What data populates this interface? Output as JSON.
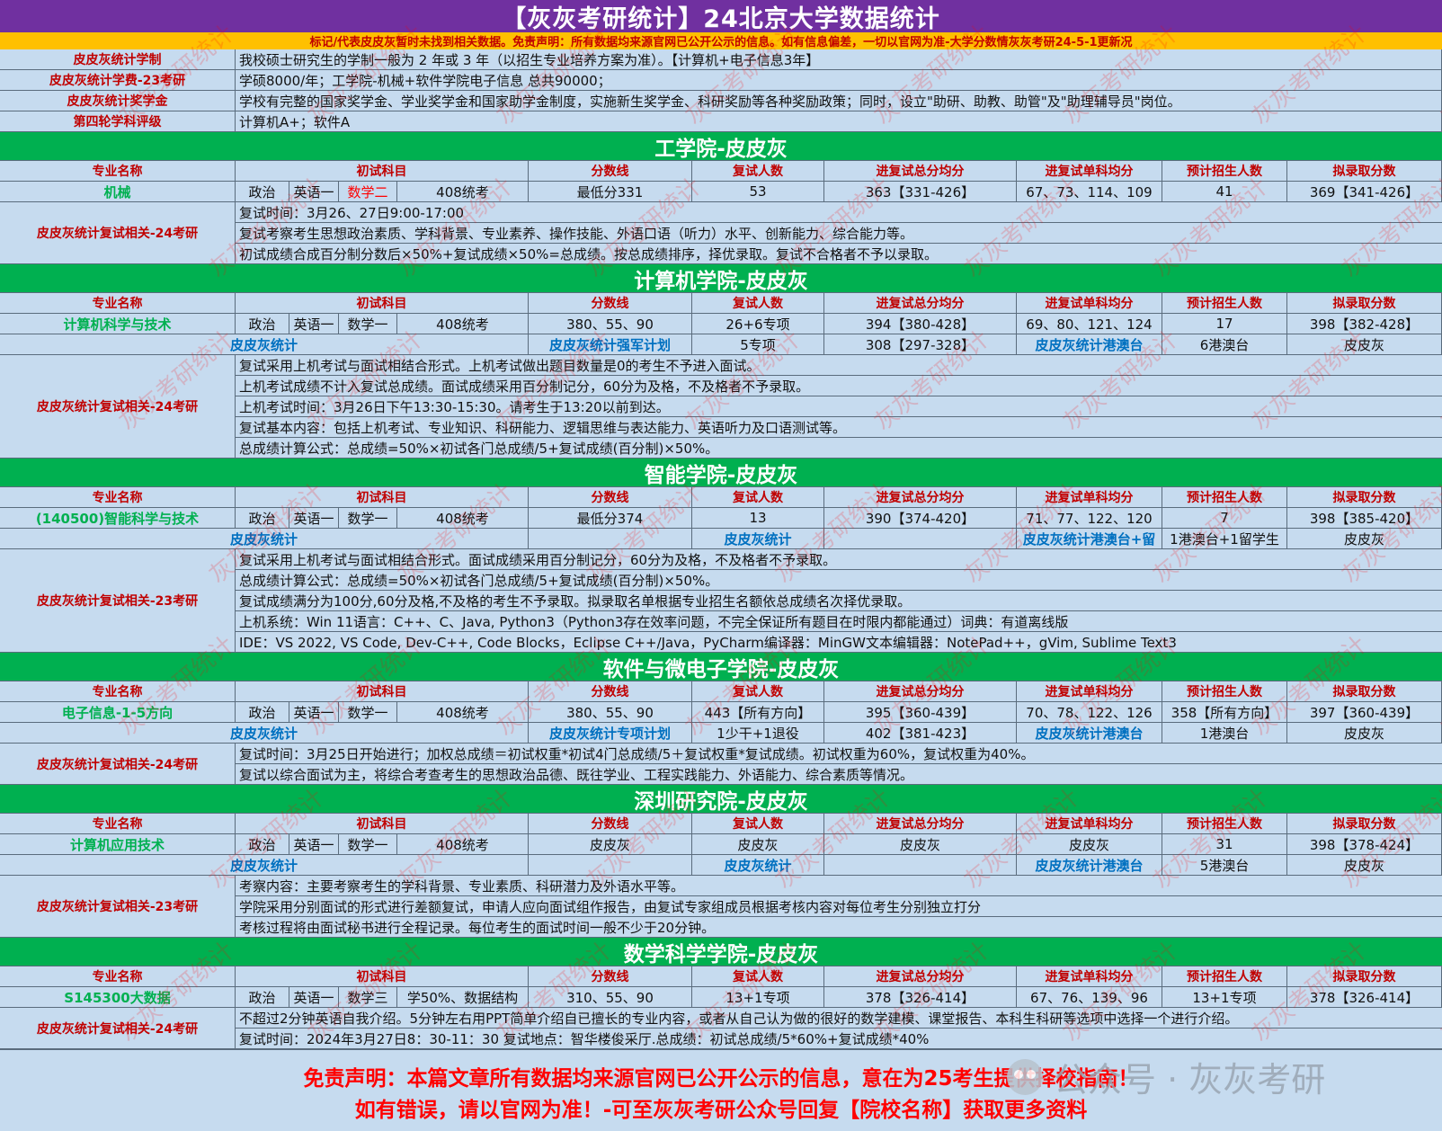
{
  "title": "【灰灰考研统计】24北京大学数据统计",
  "notice": "标记/代表皮皮灰暂时未找到相关数据。免责声明：所有数据均来源官网已公开公示的信息。如有信息偏差，一切以官网为准-大学分数情灰灰考研24-5-1更新况",
  "info_rows": [
    {
      "label": "皮皮灰统计学制",
      "value": "我校硕士研究生的学制一般为 2 年或 3 年（以招生专业培养方案为准）。【计算机+电子信息3年】"
    },
    {
      "label": "皮皮灰统计学费-23考研",
      "value": "学硕8000/年；工学院-机械+软件学院电子信息 总共90000；"
    },
    {
      "label": "皮皮灰统计奖学金",
      "value": "学校有完整的国家奖学金、学业奖学金和国家助学金制度，实施新生奖学金、科研奖励等各种奖励政策；同时，设立\"助研、助教、助管\"及\"助理辅导员\"岗位。"
    },
    {
      "label": "第四轮学科评级",
      "value": "计算机A+；软件A"
    }
  ],
  "headers": {
    "major": "专业名称",
    "subjects": "初试科目",
    "cutoff": "分数线",
    "retest_count": "复试人数",
    "avg_total": "进复试总分均分",
    "avg_single": "进复试单科均分",
    "plan": "预计招生人数",
    "admit": "拟录取分数"
  },
  "sections": [
    {
      "title": "工学院-皮皮灰",
      "major": "机械",
      "s1": "政治",
      "s2": "英语一",
      "s3": "数学二",
      "s3_red": true,
      "s4": "408统考",
      "cutoff": "最低分331",
      "retest_count": "53",
      "avg_total": "363【331-426】",
      "avg_single": "67、73、114、109",
      "plan": "41",
      "admit": "369【341-426】",
      "extra": [],
      "block_label": "皮皮灰统计复试相关-24考研",
      "lines": [
        "复试时间：3月26、27日9:00-17:00",
        "复试考察考生思想政治素质、学科背景、专业素养、操作技能、外语口语（听力）水平、创新能力、综合能力等。",
        "初试成绩合成百分制分数后×50%+复试成绩×50%=总成绩。按总成绩排序，择优录取。复试不合格者不予以录取。"
      ]
    },
    {
      "title": "计算机学院-皮皮灰",
      "major": "计算机科学与技术",
      "s1": "政治",
      "s2": "英语一",
      "s3": "数学一",
      "s3_red": false,
      "s4": "408统考",
      "cutoff": "380、55、90",
      "retest_count": "26+6专项",
      "avg_total": "394【380-428】",
      "avg_single": "69、80、121、124",
      "plan": "17",
      "admit": "398【382-428】",
      "extra": [
        {
          "a": "皮皮灰统计",
          "b": "皮皮灰统计强军计划",
          "c": "5专项",
          "d": "308【297-328】",
          "e": "皮皮灰统计港澳台",
          "f": "6港澳台",
          "g": "皮皮灰"
        }
      ],
      "block_label": "皮皮灰统计复试相关-24考研",
      "lines": [
        "复试采用上机考试与面试相结合形式。上机考试做出题目数量是0的考生不予进入面试。",
        "上机考试成绩不计入复试总成绩。面试成绩采用百分制记分，60分为及格，不及格者不予录取。",
        "上机考试时间：3月26日下午13:30-15:30。请考生于13:20以前到达。",
        "复试基本内容：包括上机考试、专业知识、科研能力、逻辑思维与表达能力、英语听力及口语测试等。",
        "总成绩计算公式：总成绩=50%×初试各门总成绩/5+复试成绩(百分制)×50%。"
      ]
    },
    {
      "title": "智能学院-皮皮灰",
      "major": "(140500)智能科学与技术",
      "s1": "政治",
      "s2": "英语一",
      "s3": "数学一",
      "s3_red": false,
      "s4": "408统考",
      "cutoff": "最低分374",
      "retest_count": "13",
      "avg_total": "390【374-420】",
      "avg_single": "71、77、122、120",
      "plan": "7",
      "admit": "398【385-420】",
      "extra": [
        {
          "a": "皮皮灰统计",
          "b": "",
          "c": "皮皮灰统计",
          "d": "",
          "e": "皮皮灰统计港澳台+留",
          "f": "1港澳台+1留学生",
          "g": "皮皮灰",
          "c_blue": true
        }
      ],
      "block_label": "皮皮灰统计复试相关-23考研",
      "lines": [
        "复试采用上机考试与面试相结合形式。面试成绩采用百分制记分，60分为及格，不及格者不予录取。",
        "总成绩计算公式：总成绩=50%×初试各门总成绩/5+复试成绩(百分制)×50%。",
        "复试成绩满分为100分,60分及格,不及格的考生不予录取。拟录取名单根据专业招生名额依总成绩名次择优录取。",
        "上机系统：Win 11语言：C++、C、Java, Python3（Python3存在效率问题，不完全保证所有题目在时限内都能通过）词典：有道离线版",
        "IDE：VS 2022, VS Code, Dev-C++, Code Blocks，Eclipse C++/Java，PyCharm编译器：MinGW文本编辑器：NotePad++，gVim, Sublime Text3"
      ]
    },
    {
      "title": "软件与微电子学院-皮皮灰",
      "major": "电子信息-1-5方向",
      "s1": "政治",
      "s2": "英语一",
      "s3": "数学一",
      "s3_red": false,
      "s4": "408统考",
      "cutoff": "380、55、90",
      "retest_count": "443【所有方向】",
      "avg_total": "395【360-439】",
      "avg_single": "70、78、122、126",
      "plan": "358【所有方向】",
      "admit": "397【360-439】",
      "extra": [
        {
          "a": "皮皮灰统计",
          "b": "皮皮灰统计专项计划",
          "c": "1少干+1退役",
          "d": "402【381-423】",
          "e": "皮皮灰统计港澳台",
          "f": "1港澳台",
          "g": "皮皮灰"
        }
      ],
      "block_label": "皮皮灰统计复试相关-24考研",
      "lines": [
        "复试时间：3月25日开始进行；加权总成绩＝初试权重*初试4门总成绩/5＋复试权重*复试成绩。初试权重为60%，复试权重为40%。",
        "复试以综合面试为主，将综合考查考生的思想政治品德、既往学业、工程实践能力、外语能力、综合素质等情况。"
      ]
    },
    {
      "title": "深圳研究院-皮皮灰",
      "major": "计算机应用技术",
      "s1": "政治",
      "s2": "英语一",
      "s3": "数学一",
      "s3_red": false,
      "s4": "408统考",
      "cutoff": "皮皮灰",
      "retest_count": "皮皮灰",
      "avg_total": "皮皮灰",
      "avg_single": "皮皮灰",
      "plan": "31",
      "admit": "398【378-424】",
      "extra": [
        {
          "a": "皮皮灰统计",
          "b": "",
          "c": "皮皮灰统计",
          "d": "",
          "e": "皮皮灰统计港澳台",
          "f": "5港澳台",
          "g": "皮皮灰",
          "c_blue": true
        }
      ],
      "block_label": "皮皮灰统计复试相关-23考研",
      "lines": [
        "考察内容：主要考察考生的学科背景、专业素质、科研潜力及外语水平等。",
        "学院采用分别面试的形式进行差额复试，申请人应向面试组作报告，由复试专家组成员根据考核内容对每位考生分别独立打分",
        "考核过程将由面试秘书进行全程记录。每位考生的面试时间一般不少于20分钟。"
      ]
    },
    {
      "title": "数学科学学院-皮皮灰",
      "major": "S145300大数据",
      "s1": "政治",
      "s2": "英语一",
      "s3": "数学三",
      "s3_red": false,
      "s4": "学50%、数据结构",
      "cutoff": "310、55、90",
      "retest_count": "13+1专项",
      "avg_total": "378【326-414】",
      "avg_single": "67、76、139、96",
      "plan": "13+1专项",
      "admit": "378【326-414】",
      "extra": [],
      "block_label": "皮皮灰统计复试相关-24考研",
      "lines": [
        "不超过2分钟英语自我介绍。5分钟左右用PPT简单介绍自已擅长的专业内容，或者从自己认为做的很好的数学建模、课堂报告、本科生科研等选项中选择一个进行介绍。",
        "复试时间：2024年3月27日8：30-11：30 复试地点：智华楼俊采厅.总成绩：初试总成绩/5*60%+复试成绩*40%"
      ]
    }
  ],
  "footer": {
    "line1": "免责声明：本篇文章所有数据均来源官网已公开公示的信息，意在为25考生提供择校指南！",
    "line2": "如有错误，请以官网为准！-可至灰灰考研公众号回复【院校名称】获取更多资料"
  },
  "wechat_tag": "公众号 · 灰灰考研",
  "watermark_text": "灰灰考研统计",
  "colors": {
    "title_bg": "#7030a0",
    "notice_bg": "#ffc000",
    "section_bg": "#00b050",
    "cell_bg": "#c6dbef",
    "label_red": "#c00000",
    "major_green": "#00b050",
    "link_blue": "#0070c0"
  }
}
